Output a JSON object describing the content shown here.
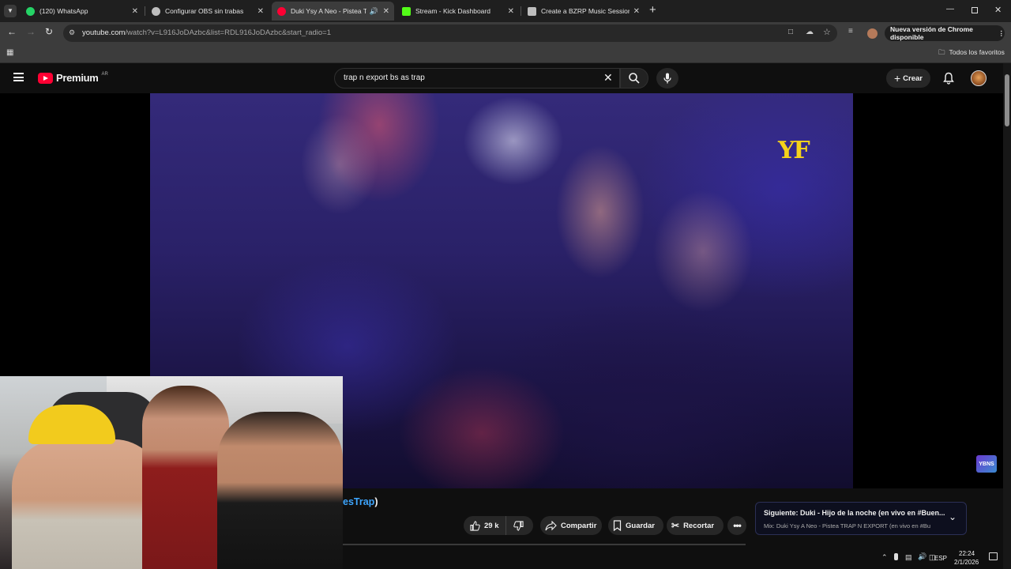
{
  "tabs": [
    {
      "label": "(120) WhatsApp",
      "favicon_color": "#25d366",
      "active": false
    },
    {
      "label": "Configurar OBS sin trabas",
      "favicon_color": "#bdbdbd",
      "active": false
    },
    {
      "label": "Duki Ysy A Neo - Pistea TR",
      "favicon_color": "#ff0033",
      "active": true
    },
    {
      "label": "Stream - Kick Dashboard",
      "favicon_color": "#53fc18",
      "active": false
    },
    {
      "label": "Create a BZRP Music Sessions",
      "favicon_color": "#bdbdbd",
      "active": false
    }
  ],
  "browser": {
    "url_host": "youtube.com",
    "url_path": "/watch?v=L916JoDAzbc&list=RDL916JoDAzbc&start_radio=1",
    "update_button": "Nueva versión de Chrome disponible",
    "bookmarks_label": "Todos los favoritos"
  },
  "youtube": {
    "logo_text": "Premium",
    "country_code": "AR",
    "search_query": "trap n export bs as trap",
    "create_label": "Crear"
  },
  "video": {
    "watermark": "YF",
    "corner_logo": "YBNS"
  },
  "info": {
    "title_fragment": "esTrap",
    "title_suffix": ")",
    "likes": "29 k",
    "share_label": "Compartir",
    "save_label": "Guardar",
    "clip_label": "Recortar"
  },
  "next_card": {
    "title": "Siguiente: Duki - Hijo de la noche (en vivo en #Buen...",
    "subtitle": "Mix: Duki Ysy A Neo - Pistea TRAP N EXPORT  (en vivo en #Bu"
  },
  "taskbar": {
    "language": "ESP",
    "time": "22:24",
    "date": "2/1/2026"
  },
  "colors": {
    "youtube_red": "#ff0033",
    "link_blue": "#3ea6ff",
    "accent_yellow": "#f5d31a"
  }
}
